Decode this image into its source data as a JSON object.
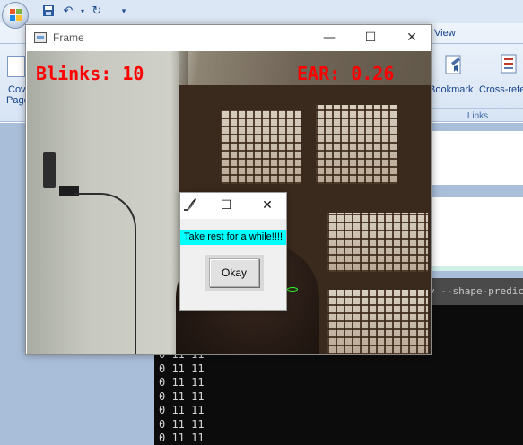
{
  "word": {
    "ribbon_tab_view": "View",
    "labels": {
      "cover_page_line1": "Cov",
      "cover_page_line2": "Page",
      "bookmark": "Bookmark",
      "cross_reference": "Cross-refe"
    },
    "group_links": "Links",
    "quick_access": {
      "save_icon": "save-icon",
      "undo_icon": "undo-icon",
      "redo_icon": "redo-icon",
      "customize_icon": "customize-icon"
    }
  },
  "terminal": {
    "title_fragment": "y --shape-predicto",
    "lines": [
      "0 11 11",
      "0 11 11",
      "0 11 11",
      "0 11 11",
      "0 11 11",
      "0 11 11",
      "0 11 11"
    ]
  },
  "frame": {
    "title": "Frame",
    "controls": {
      "minimize": "—",
      "maximize": "☐",
      "close": "✕"
    },
    "overlay": {
      "blinks": "Blinks: 10",
      "ear": "EAR: 0.26",
      "color": "#ff0000"
    }
  },
  "popup": {
    "controls": {
      "maximize": "☐",
      "close": "✕"
    },
    "message": "Take rest for a while!!!!",
    "message_bg": "#00ffff",
    "ok_label": "Okay"
  }
}
